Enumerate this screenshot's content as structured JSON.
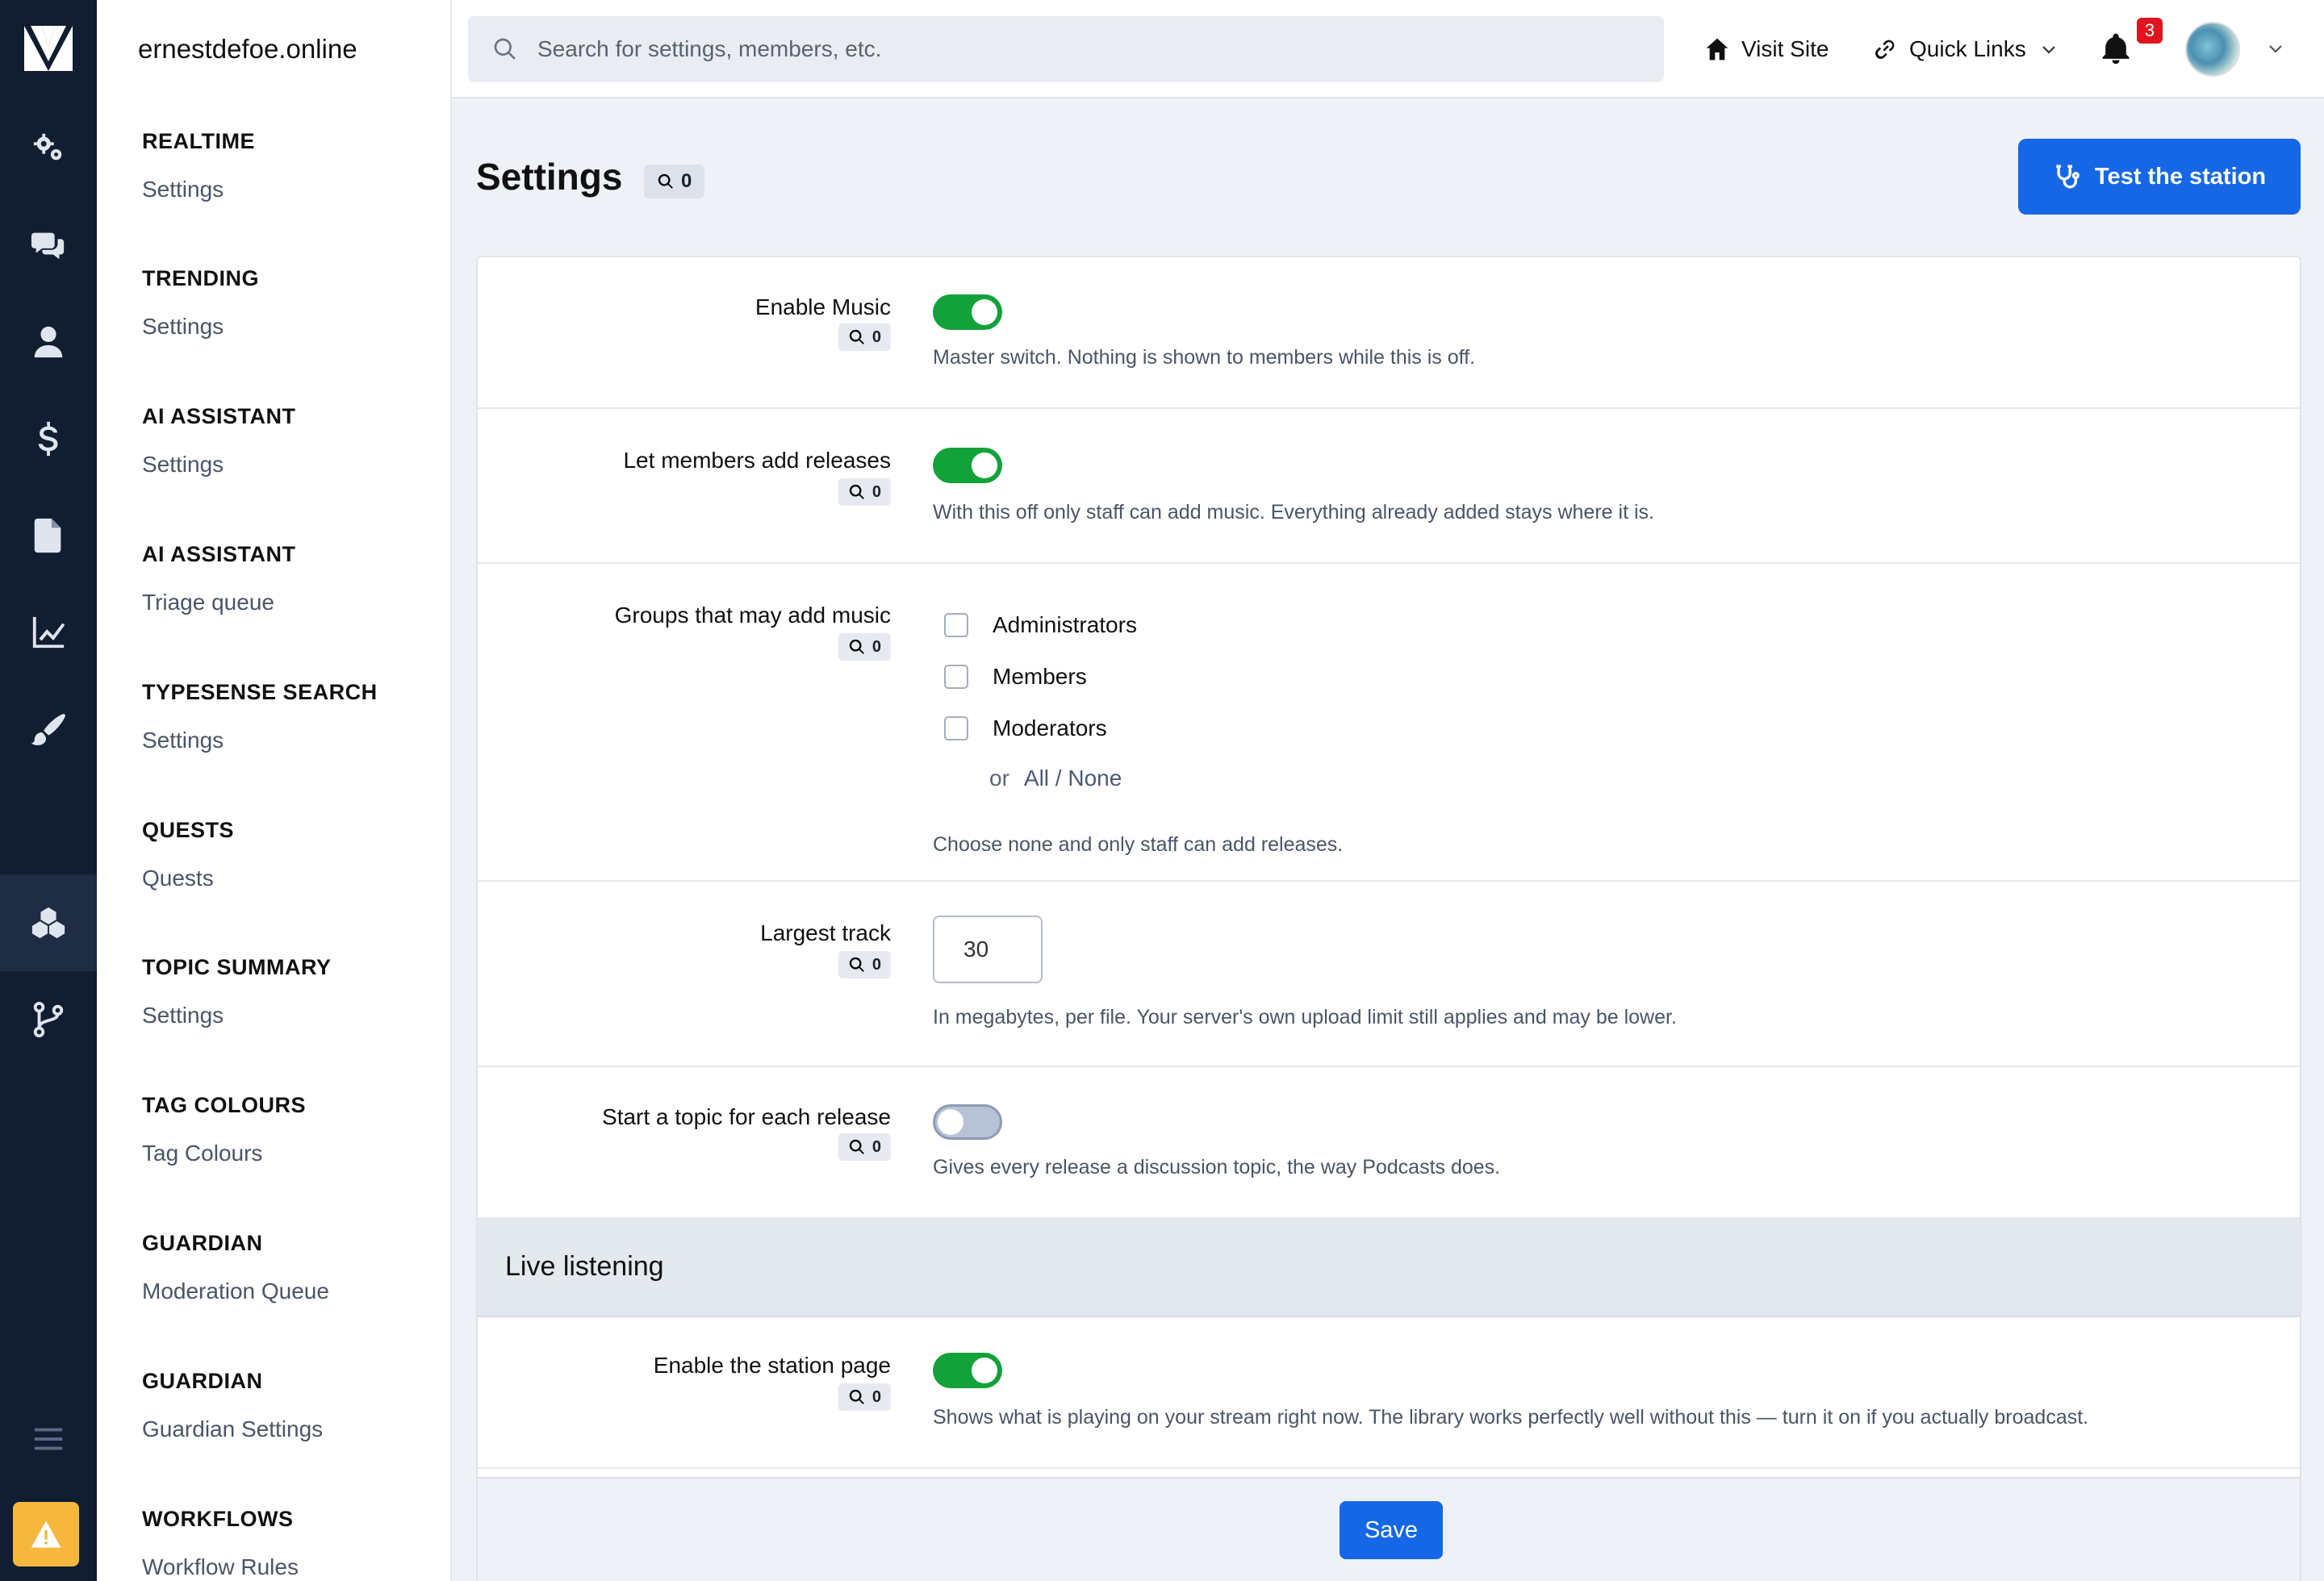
{
  "site_name": "ernestdefoe.online",
  "rail_icons": [
    "wrench-gears-icon",
    "chat-bubbles-icon",
    "person-icon",
    "dollar-icon",
    "document-icon",
    "chart-icon",
    "paintbrush-icon",
    "plugins-icon",
    "git-branch-icon"
  ],
  "nav": [
    {
      "title": "REALTIME",
      "link": "Settings"
    },
    {
      "title": "TRENDING",
      "link": "Settings"
    },
    {
      "title": "AI ASSISTANT",
      "link": "Settings"
    },
    {
      "title": "AI ASSISTANT",
      "link": "Triage queue"
    },
    {
      "title": "TYPESENSE SEARCH",
      "link": "Settings"
    },
    {
      "title": "QUESTS",
      "link": "Quests"
    },
    {
      "title": "TOPIC SUMMARY",
      "link": "Settings"
    },
    {
      "title": "TAG COLOURS",
      "link": "Tag Colours"
    },
    {
      "title": "GUARDIAN",
      "link": "Moderation Queue"
    },
    {
      "title": "GUARDIAN",
      "link": "Guardian Settings"
    },
    {
      "title": "WORKFLOWS",
      "link": "Workflow Rules"
    }
  ],
  "topbar": {
    "search_placeholder": "Search for settings, members, etc.",
    "visit_site": "Visit Site",
    "quick_links": "Quick Links",
    "notification_count": "3"
  },
  "page": {
    "title": "Settings",
    "count": "0",
    "test_button": "Test the station"
  },
  "settings": {
    "enable_music": {
      "label": "Enable Music",
      "count": "0",
      "enabled": true,
      "desc": "Master switch. Nothing is shown to members while this is off."
    },
    "members_add": {
      "label": "Let members add releases",
      "count": "0",
      "enabled": true,
      "desc": "With this off only staff can add music. Everything already added stays where it is."
    },
    "groups": {
      "label": "Groups that may add music",
      "count": "0",
      "options": [
        "Administrators",
        "Members",
        "Moderators"
      ],
      "or": "or",
      "all_none": "All / None",
      "desc": "Choose none and only staff can add releases."
    },
    "largest_track": {
      "label": "Largest track",
      "count": "0",
      "value": "30",
      "desc": "In megabytes, per file. Your server's own upload limit still applies and may be lower."
    },
    "topic_each": {
      "label": "Start a topic for each release",
      "count": "0",
      "enabled": false,
      "desc": "Gives every release a discussion topic, the way Podcasts does."
    }
  },
  "live_section": {
    "title": "Live listening",
    "station_page": {
      "label": "Enable the station page",
      "count": "0",
      "enabled": true,
      "desc": "Shows what is playing on your stream right now. The library works perfectly well without this — turn it on if you actually broadcast."
    }
  },
  "save_label": "Save"
}
